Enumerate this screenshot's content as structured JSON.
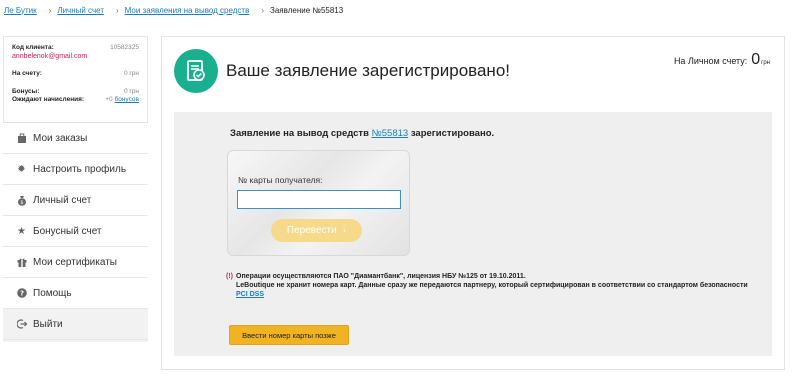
{
  "breadcrumb": {
    "items": [
      "Ле Бутик",
      "Личный счет",
      "Мои заявления на вывод средств"
    ],
    "current": "Заявление №55813"
  },
  "account": {
    "client_code_label": "Код клиента:",
    "client_code": "10582325",
    "email": "annbelenok@gmail.com",
    "balance_label": "На счету:",
    "balance_value": "0 грн",
    "bonus_label": "Бонусы:",
    "bonus_value": "0 грн",
    "pending_label": "Ожидают начисления:",
    "pending_value": "+0",
    "pending_link": "бонусов"
  },
  "menu": {
    "items": [
      {
        "label": "Мои заказы",
        "icon": "bag-icon"
      },
      {
        "label": "Настроить профиль",
        "icon": "gear-icon"
      },
      {
        "label": "Личный счет",
        "icon": "money-bag-icon"
      },
      {
        "label": "Бонусный счет",
        "icon": "star-icon"
      },
      {
        "label": "Мои сертификаты",
        "icon": "gift-icon"
      },
      {
        "label": "Помощь",
        "icon": "help-icon"
      },
      {
        "label": "Выйти",
        "icon": "logout-icon"
      }
    ]
  },
  "main": {
    "headline": "Ваше заявление зарегистрировано!",
    "balance_label": "На Личном счету:",
    "balance_value": "0",
    "balance_currency": "грн",
    "statement_prefix": "Заявление на вывод средств",
    "statement_link": "№55813",
    "statement_suffix": "зарегистировано.",
    "card_label": "№ карты получателя:",
    "card_value": "",
    "card_placeholder": "",
    "submit_label": "Перевести",
    "notice_mark": "(!)",
    "notice_line1": "Операции осуществляются ПАО \"Диамантбанк\", лицензия НБУ №125 от 19.10.2011.",
    "notice_line2": "LeBoutique не хранит номера карт. Данные сразу же передаются партнеру, который сертифицирован в соответствии со стандартом безопасности",
    "notice_link": "PCI DSS",
    "later_label": "Ввести номер карты позже"
  },
  "colors": {
    "accent_green": "#1ab08f",
    "link_blue": "#1a7db5",
    "email_pink": "#d0215a",
    "button_orange": "#f0b324",
    "button_disabled": "#f7d98a"
  }
}
